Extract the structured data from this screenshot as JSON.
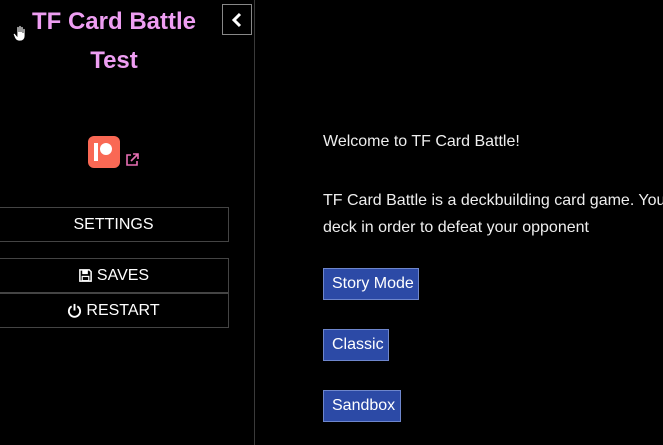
{
  "sidebar": {
    "title_line1": "TF Card Battle",
    "title_line2": "Test",
    "collapse_icon": "chevron-left-icon",
    "patreon_icon": "patreon-icon",
    "external_link_icon": "external-link-icon",
    "settings_label": "SETTINGS",
    "saves_label": "SAVES",
    "saves_icon": "floppy-disk-icon",
    "restart_label": "RESTART",
    "restart_icon": "power-icon"
  },
  "passage": {
    "welcome": "Welcome to TF Card Battle!",
    "intro_line1": "TF Card Battle is a deckbuilding card game. You",
    "intro_line2": "deck in order to defeat your opponent",
    "story_mode_label": "Story Mode",
    "classic_label": "Classic",
    "sandbox_label": "Sandbox"
  },
  "colors": {
    "title": "#ee9ef2",
    "button_bg": "#2c4aa6",
    "patreon": "#f96854",
    "link_icon": "#e86fb4"
  }
}
